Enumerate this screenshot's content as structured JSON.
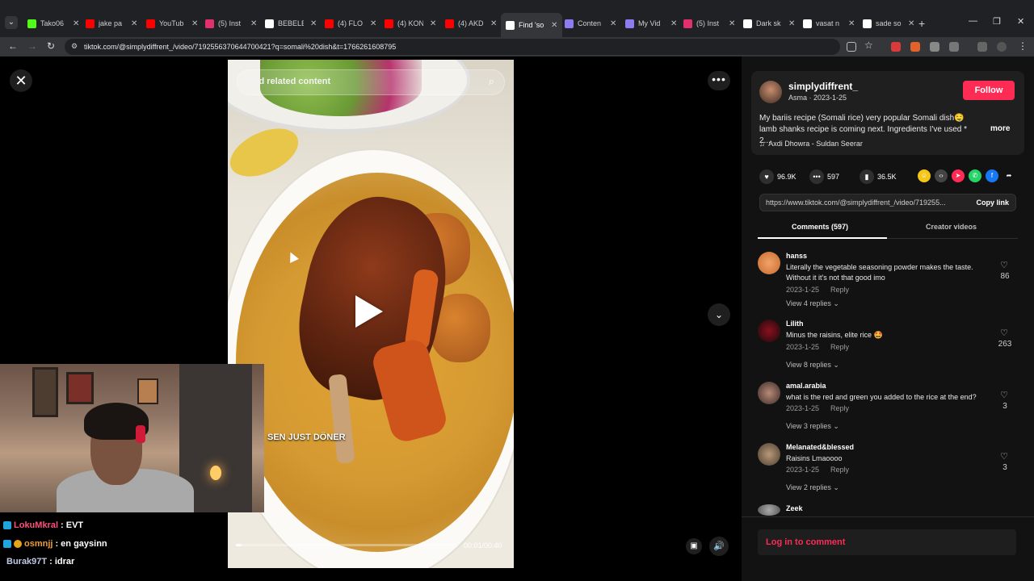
{
  "browser": {
    "tabs": [
      {
        "label": "Tako06",
        "color": "#53fc18"
      },
      {
        "label": "jake pa",
        "color": "#ff0000"
      },
      {
        "label": "YouTub",
        "color": "#ff0000"
      },
      {
        "label": "(5) Inst",
        "color": "#e1306c"
      },
      {
        "label": "BEBELE",
        "color": "#ffffff"
      },
      {
        "label": "(4) FLO",
        "color": "#ff0000"
      },
      {
        "label": "(4) KON",
        "color": "#ff0000"
      },
      {
        "label": "(4) AKD",
        "color": "#ff0000"
      },
      {
        "label": "Find 'so",
        "color": "#ffffff",
        "active": true
      },
      {
        "label": "Conten",
        "color": "#8c7cf0"
      },
      {
        "label": "My Vid",
        "color": "#8c7cf0"
      },
      {
        "label": "(5) Inst",
        "color": "#e1306c"
      },
      {
        "label": "Dark sk",
        "color": "#ffffff"
      },
      {
        "label": "vasat n",
        "color": "#ffffff"
      },
      {
        "label": "sade so",
        "color": "#ffffff"
      }
    ],
    "url": "tiktok.com/@simplydiffrent_/video/7192556370644700421?q=somali%20dish&t=1766261608795"
  },
  "video": {
    "search_placeholder": "Find related content",
    "time": "00:01/00:40",
    "progress": 0.025
  },
  "post": {
    "username": "simplydiffrent_",
    "subline": "Asma · 2023-1-25",
    "follow_label": "Follow",
    "description": "My bariis recipe (Somali rice) very popular Somali dish🤤 lamb shanks recipe is coming next. Ingredients I've used * 2...",
    "more_label": "more",
    "music": "Axdi Dhowra - Suldan Seerar",
    "likes": "96.9K",
    "comments": "597",
    "saves": "36.5K",
    "link": "https://www.tiktok.com/@simplydiffrent_/video/719255...",
    "copy_label": "Copy link"
  },
  "tabs": {
    "comments": "Comments (597)",
    "creator": "Creator videos"
  },
  "comments": [
    {
      "name": "hanss",
      "text": "Literally the vegetable seasoning powder makes the taste. Without it it's not that good imo",
      "date": "2023-1-25",
      "reply": "Reply",
      "replies": "View 4 replies",
      "likes": "86"
    },
    {
      "name": "Lilith",
      "text": "Minus the raisins, elite rice 🤩",
      "date": "2023-1-25",
      "reply": "Reply",
      "replies": "View 8 replies",
      "likes": "263"
    },
    {
      "name": "amal.arabia",
      "text": "what is the red and green you added to the rice at the end?",
      "date": "2023-1-25",
      "reply": "Reply",
      "replies": "View 3 replies",
      "likes": "3"
    },
    {
      "name": "Melanated&blessed",
      "text": "Raisins Lmaoooo",
      "date": "2023-1-25",
      "reply": "Reply",
      "replies": "View 2 replies",
      "likes": "3"
    },
    {
      "name": "Zeek"
    }
  ],
  "login_label": "Log in to comment",
  "stream": {
    "overlay_text": "SEN JUST DÖNER",
    "chat": [
      {
        "user": "LokuMkral",
        "msg": ": EVT",
        "color": "#ff4f7b"
      },
      {
        "user": "osmnjj",
        "msg": ": en gaysinn",
        "color": "#f0a030"
      },
      {
        "user": "Burak97T",
        "msg": ": idrar",
        "color": "#bfc9e6"
      }
    ]
  }
}
